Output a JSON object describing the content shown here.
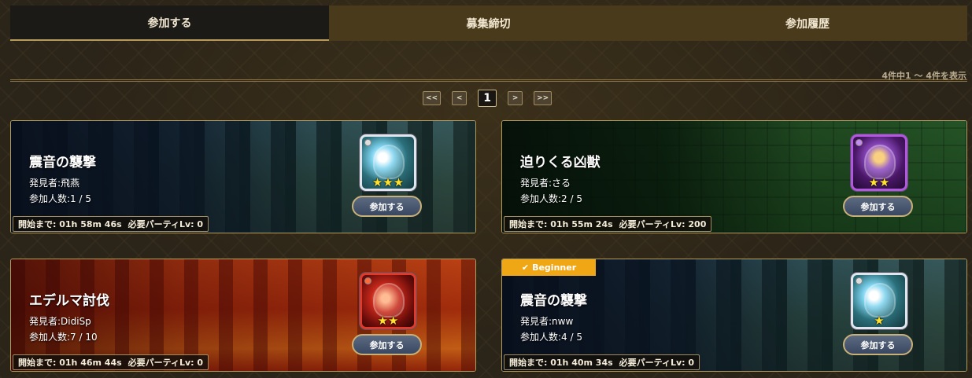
{
  "tabs": [
    {
      "label": "参加する",
      "active": true
    },
    {
      "label": "募集締切",
      "active": false
    },
    {
      "label": "参加履歴",
      "active": false
    }
  ],
  "result_count": "4件中1 ～ 4件を表示",
  "pagination": {
    "first": "<<",
    "prev": "<",
    "current": "1",
    "next": ">",
    "last": ">>"
  },
  "cards": [
    {
      "title": "震音の襲撃",
      "discoverer": "発見者:飛燕",
      "participants": "参加人数:1 / 5",
      "start_label": "開始まで: 01h 58m 46s",
      "level_label": "必要パーティLv: 0",
      "stars": "★★★",
      "join_label": "参加する",
      "background": "forest",
      "monster_icon": "wind-monster-icon",
      "badge": null
    },
    {
      "title": "迫りくる凶獣",
      "discoverer": "発見者:さる",
      "participants": "参加人数:2 / 5",
      "start_label": "開始まで: 01h 55m 24s",
      "level_label": "必要パーティLv: 200",
      "stars": "★★",
      "join_label": "参加する",
      "background": "ruins",
      "monster_icon": "dark-monster-icon",
      "badge": null
    },
    {
      "title": "エデルマ討伐",
      "discoverer": "発見者:DidiSp",
      "participants": "参加人数:7 / 10",
      "start_label": "開始まで: 01h 46m 44s",
      "level_label": "必要パーティLv: 0",
      "stars": "★★",
      "join_label": "参加する",
      "background": "lava",
      "monster_icon": "fire-monster-icon",
      "badge": null
    },
    {
      "title": "震音の襲撃",
      "discoverer": "発見者:nww",
      "participants": "参加人数:4 / 5",
      "start_label": "開始まで: 01h 40m 34s",
      "level_label": "必要パーティLv: 0",
      "stars": "★",
      "join_label": "参加する",
      "background": "forest",
      "monster_icon": "wind-monster-icon",
      "badge": "Beginner"
    }
  ],
  "colors": {
    "tab_active": "#1c1a16",
    "tab_inactive": "#4a3a1c",
    "gold_border": "#b49b5e",
    "badge": "#f0a716",
    "star": "#ffe22e"
  }
}
